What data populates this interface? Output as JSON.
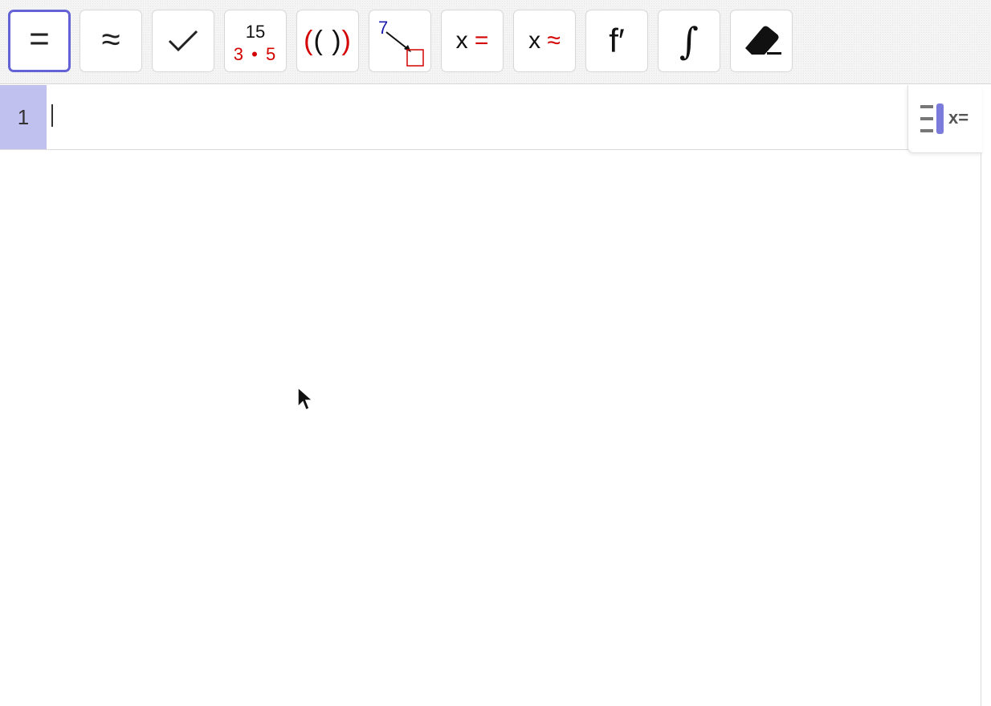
{
  "toolbar": {
    "tools": [
      {
        "id": "evaluate",
        "label": "=",
        "selected": true
      },
      {
        "id": "numeric",
        "label": "≈"
      },
      {
        "id": "keep-input",
        "label": "✓"
      },
      {
        "id": "factor",
        "numerator": "15",
        "denominator": "3 • 5"
      },
      {
        "id": "expand",
        "label": "(( ))"
      },
      {
        "id": "substitute",
        "number": "7"
      },
      {
        "id": "solve",
        "var": "x",
        "sign": "="
      },
      {
        "id": "nsolve",
        "var": "x",
        "sign": "≈"
      },
      {
        "id": "derivative",
        "label": "f′"
      },
      {
        "id": "integral",
        "label": "∫"
      },
      {
        "id": "delete",
        "icon": "eraser-icon"
      }
    ]
  },
  "rows": [
    {
      "number": "1",
      "input": ""
    }
  ],
  "side_panel": {
    "icon": "algebra-view-icon",
    "text": "x="
  },
  "colors": {
    "accent": "#6463d6",
    "row_highlight": "#c1c1ef",
    "red": "#d40000"
  }
}
